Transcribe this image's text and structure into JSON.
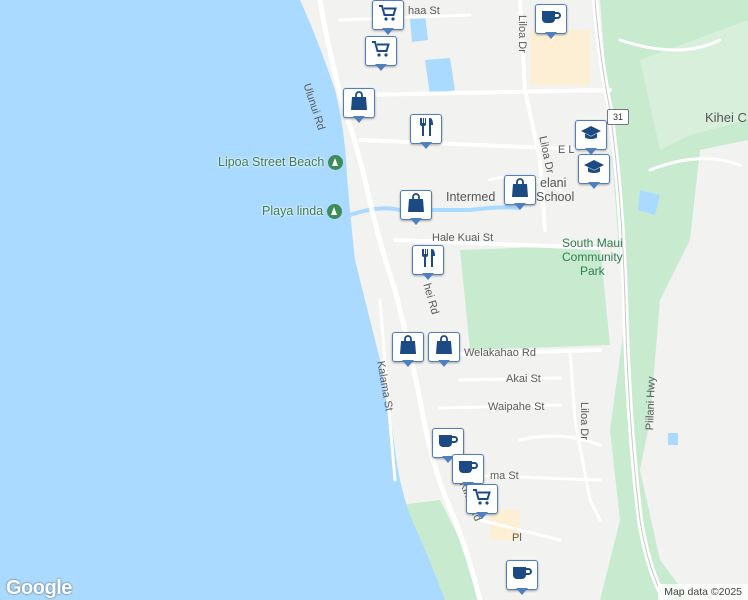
{
  "roads": {
    "ohaa": "haa St",
    "ulunui": "Ulunui Rd",
    "liloa_upper": "Liloa Dr",
    "e_lipoa": "E L",
    "kihei_c": "Kihei C",
    "hale_kuai": "Hale Kuai St",
    "kihei_rd_mid": "hei Rd",
    "welakahao": "Welakahao Rd",
    "akai": "Akai St",
    "waipahe": "Waipahe St",
    "liloa_lower": "Liloa Dr",
    "piilani": "Piilani Hwy",
    "kalama": "Kalama St",
    "kihei_rd_low": "Kihei Rd",
    "ma_st": "ma St",
    "pl": "Pl",
    "route": "31"
  },
  "places": {
    "lipoa_beach": "Lipoa Street Beach",
    "playa_linda": "Playa linda",
    "intermediate_a": "Intermed",
    "intermediate_b": "School",
    "lokelani": "elani",
    "south_maui_park": [
      "South Maui",
      "Community",
      "Park"
    ]
  },
  "markers": [
    {
      "icon": "cart-icon",
      "name": "marker-grocery-1"
    },
    {
      "icon": "cart-icon",
      "name": "marker-grocery-2"
    },
    {
      "icon": "cup-icon",
      "name": "marker-cafe-1"
    },
    {
      "icon": "bag-icon",
      "name": "marker-shop-1"
    },
    {
      "icon": "cutlery-icon",
      "name": "marker-restaurant-1"
    },
    {
      "icon": "graduation-cap-icon",
      "name": "marker-school-1"
    },
    {
      "icon": "graduation-cap-icon",
      "name": "marker-school-2"
    },
    {
      "icon": "bag-icon",
      "name": "marker-shop-2"
    },
    {
      "icon": "bag-icon",
      "name": "marker-shop-3"
    },
    {
      "icon": "cutlery-icon",
      "name": "marker-restaurant-2"
    },
    {
      "icon": "bag-icon",
      "name": "marker-shop-4"
    },
    {
      "icon": "bag-icon",
      "name": "marker-shop-5"
    },
    {
      "icon": "cup-icon",
      "name": "marker-cafe-2"
    },
    {
      "icon": "cup-icon",
      "name": "marker-cafe-3"
    },
    {
      "icon": "cart-icon",
      "name": "marker-grocery-3"
    },
    {
      "icon": "cup-icon",
      "name": "marker-cafe-4"
    }
  ],
  "colors": {
    "water": "#aadaff",
    "land": "#f2f2f0",
    "park": "#c8ebd0",
    "commercial": "#fcefd4",
    "marker_icon": "#1c4a82"
  },
  "attribution": {
    "logo": "Google",
    "data": "Map data ©2025"
  }
}
